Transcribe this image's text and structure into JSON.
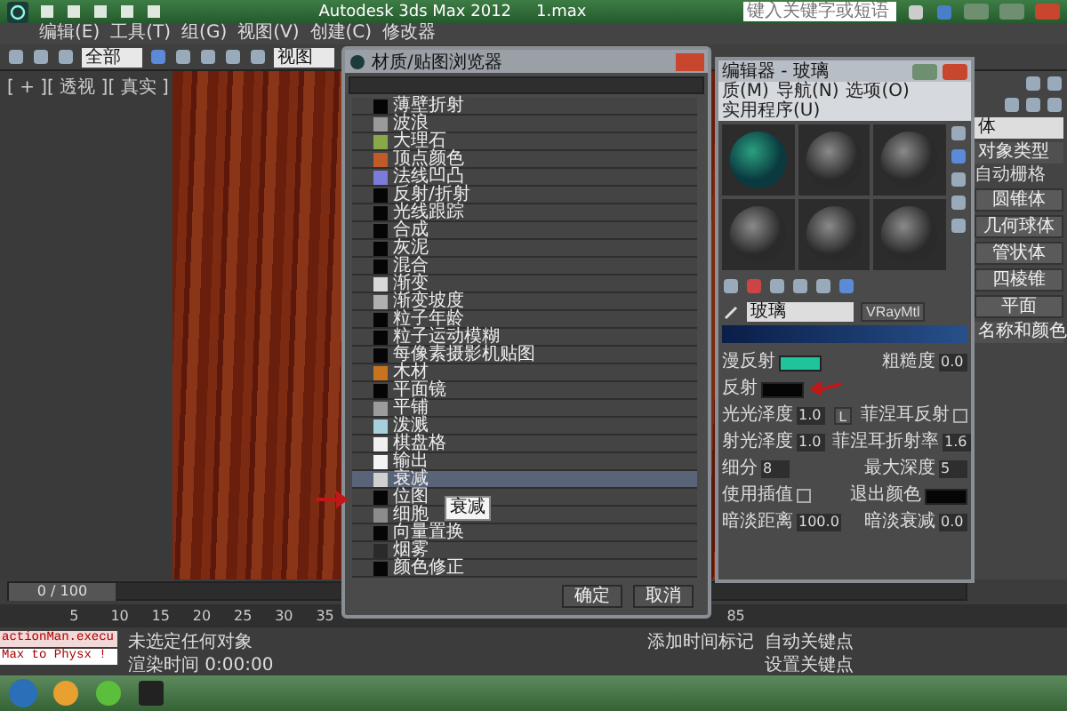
{
  "app": {
    "title": "Autodesk 3ds Max  2012",
    "file": "1.max",
    "search_placeholder": "键入关键字或短语"
  },
  "menus": [
    "编辑(E)",
    "工具(T)",
    "组(G)",
    "视图(V)",
    "创建(C)",
    "修改器"
  ],
  "toolbar": {
    "selection_filter": "全部",
    "coordinate": "视图"
  },
  "viewport": {
    "label": "[ + ][ 透视 ][ 真实 ]"
  },
  "browser": {
    "title": "材质/贴图浏览器",
    "items": [
      {
        "label": "薄壁折射",
        "selected": false,
        "color": "#050505"
      },
      {
        "label": "波浪",
        "selected": false,
        "color": "#9a9a9a"
      },
      {
        "label": "大理石",
        "selected": false,
        "color": "#8aa84a"
      },
      {
        "label": "顶点颜色",
        "selected": false,
        "color": "#c05a28"
      },
      {
        "label": "法线凹凸",
        "selected": false,
        "color": "#7b7bd8"
      },
      {
        "label": "反射/折射",
        "selected": false,
        "color": "#050505"
      },
      {
        "label": "光线跟踪",
        "selected": false,
        "color": "#050505"
      },
      {
        "label": "合成",
        "selected": false,
        "color": "#050505"
      },
      {
        "label": "灰泥",
        "selected": false,
        "color": "#050505"
      },
      {
        "label": "混合",
        "selected": false,
        "color": "#050505"
      },
      {
        "label": "渐变",
        "selected": false,
        "color": "#d8d8d8"
      },
      {
        "label": "渐变坡度",
        "selected": false,
        "color": "#b0b0b0"
      },
      {
        "label": "粒子年龄",
        "selected": false,
        "color": "#050505"
      },
      {
        "label": "粒子运动模糊",
        "selected": false,
        "color": "#050505"
      },
      {
        "label": "每像素摄影机贴图",
        "selected": false,
        "color": "#050505"
      },
      {
        "label": "木材",
        "selected": false,
        "color": "#c8741e"
      },
      {
        "label": "平面镜",
        "selected": false,
        "color": "#050505"
      },
      {
        "label": "平铺",
        "selected": false,
        "color": "#9c9c9c"
      },
      {
        "label": "泼溅",
        "selected": false,
        "color": "#a8d0dc"
      },
      {
        "label": "棋盘格",
        "selected": false,
        "color": "#f0f0f0"
      },
      {
        "label": "输出",
        "selected": false,
        "color": "#f4f4f4"
      },
      {
        "label": "衰减",
        "selected": true,
        "color": "#d0d0d0"
      },
      {
        "label": "位图",
        "selected": false,
        "color": "#050505"
      },
      {
        "label": "细胞",
        "selected": false,
        "color": "#8c8c8c"
      },
      {
        "label": "向量置换",
        "selected": false,
        "color": "#050505"
      },
      {
        "label": "烟雾",
        "selected": false,
        "color": "#2a2a2a"
      },
      {
        "label": "颜色修正",
        "selected": false,
        "color": "#050505"
      }
    ],
    "tooltip": "衰减",
    "buttons": [
      "确定",
      "取消"
    ]
  },
  "material_editor": {
    "title": "编辑器 - 玻璃",
    "menus": [
      "质(M)",
      "导航(N)",
      "选项(O)",
      "实用程序(U)"
    ],
    "material_name": "玻璃",
    "material_type": "VRayMtl",
    "rows": [
      [
        {
          "label": "漫反射",
          "kind": "swatch",
          "color": "#1fc49a"
        },
        {
          "label": "粗糙度",
          "kind": "number",
          "value": "0.0"
        }
      ],
      [
        {
          "label": "反射",
          "kind": "swatch",
          "color": "#050505"
        }
      ],
      [
        {
          "label": "光光泽度",
          "kind": "number",
          "value": "1.0"
        },
        {
          "label": "L",
          "kind": "button"
        },
        {
          "label": "菲涅耳反射",
          "kind": "checkbox",
          "checked": false
        }
      ],
      [
        {
          "label": "射光泽度",
          "kind": "number",
          "value": "1.0"
        },
        {
          "label": "菲涅耳折射率",
          "kind": "number",
          "value": "1.6"
        }
      ],
      [
        {
          "label": "细分",
          "kind": "number",
          "value": "8"
        },
        {
          "label": "最大深度",
          "kind": "number",
          "value": "5"
        }
      ],
      [
        {
          "label": "使用插值",
          "kind": "checkbox",
          "checked": false
        },
        {
          "label": "退出颜色",
          "kind": "swatch",
          "color": "#050505"
        }
      ],
      [
        {
          "label": "暗淡距离",
          "kind": "number",
          "value": "100.0"
        },
        {
          "label": "暗淡衰减",
          "kind": "number",
          "value": "0.0"
        }
      ]
    ]
  },
  "command_panel": {
    "category": "体",
    "section": "对象类型",
    "autogrid": "自动栅格",
    "buttons": [
      "圆锥体",
      "几何球体",
      "管状体",
      "四棱锥",
      "平面"
    ],
    "section2": "名称和颜色"
  },
  "timeline": {
    "frame": "0 / 100",
    "ticks": [
      "5",
      "10",
      "15",
      "20",
      "25",
      "30",
      "35",
      "85"
    ]
  },
  "status": {
    "script_lines": [
      "actionMan.execu",
      "Max to Physx !"
    ],
    "message": "未选定任何对象",
    "render_time": "渲染时间 0:00:00",
    "add_tag": "添加时间标记",
    "auto_key": "自动关键点",
    "set_key": "设置关键点"
  }
}
